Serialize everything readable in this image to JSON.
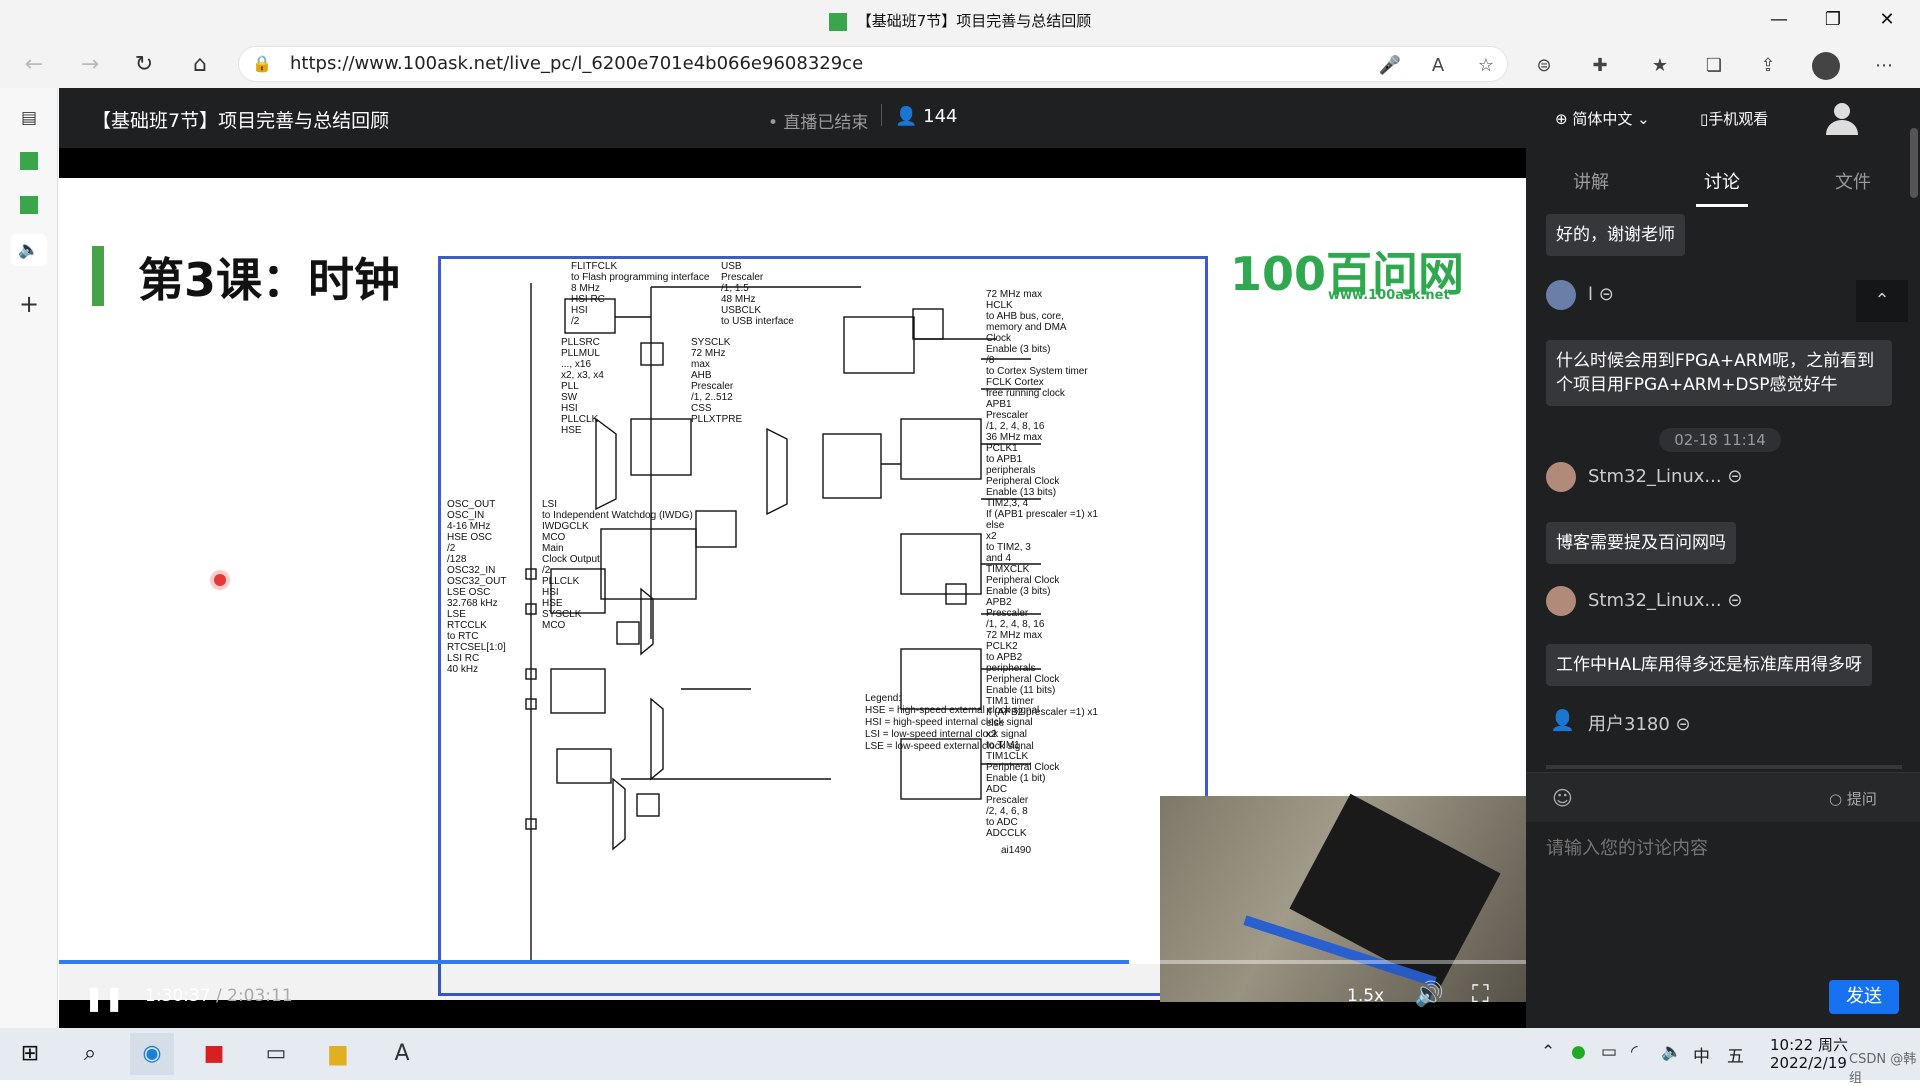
{
  "browser": {
    "tab_title": "【基础班7节】项目完善与总结回顾",
    "url": "https://www.100ask.net/live_pc/l_6200e701e4b066e9608329ce"
  },
  "page": {
    "title": "【基础班7节】项目完善与总结回顾",
    "live_status": "• 直播已结束",
    "viewer_count": "144",
    "language": "简体中文",
    "mobile_watch": "手机观看"
  },
  "slide": {
    "lesson_title": "第3课：时钟",
    "logo_text": "100百问网",
    "logo_url": "www.100ask.net"
  },
  "diagram": {
    "top_labels": [
      "FLITFCLK",
      "to Flash programming interface",
      "8 MHz",
      "HSI RC",
      "HSI",
      "/2",
      "USB",
      "Prescaler",
      "/1, 1.5",
      "48 MHz",
      "USBCLK",
      "to USB interface"
    ],
    "pll_labels": [
      "PLLSRC",
      "PLLMUL",
      "..., x16",
      "x2, x3, x4",
      "PLL",
      "SW",
      "HSI",
      "PLLCLK",
      "HSE",
      "SYSCLK",
      "72 MHz",
      "max",
      "AHB",
      "Prescaler",
      "/1, 2..512",
      "CSS",
      "PLLXTPRE"
    ],
    "osc_labels": [
      "OSC_OUT",
      "OSC_IN",
      "4-16 MHz",
      "HSE OSC",
      "/2",
      "/128",
      "OSC32_IN",
      "OSC32_OUT",
      "LSE OSC",
      "32.768 kHz",
      "LSE",
      "RTCCLK",
      "to RTC",
      "RTCSEL[1:0]",
      "LSI RC",
      "40 kHz",
      "LSI",
      "to Independent Watchdog (IWDG)",
      "IWDGCLK",
      "MCO",
      "Main",
      "Clock Output",
      "/2",
      "PLLCLK",
      "HSI",
      "HSE",
      "SYSCLK",
      "MCO"
    ],
    "right_labels": [
      "72 MHz max",
      "HCLK",
      "to AHB bus, core,",
      "memory and DMA",
      "Clock",
      "Enable (3 bits)",
      "/8",
      "to Cortex System timer",
      "FCLK Cortex",
      "free running clock",
      "APB1",
      "Prescaler",
      "/1, 2, 4, 8, 16",
      "36 MHz max",
      "PCLK1",
      "to APB1",
      "peripherals",
      "Peripheral Clock",
      "Enable (13 bits)",
      "TIM2,3, 4",
      "If (APB1 prescaler =1) x1",
      "else",
      "x2",
      "to TIM2, 3",
      "and 4",
      "TIMXCLK",
      "Peripheral Clock",
      "Enable (3 bits)",
      "APB2",
      "Prescaler",
      "/1, 2, 4, 8, 16",
      "72 MHz max",
      "PCLK2",
      "to APB2",
      "peripherals",
      "Peripheral Clock",
      "Enable (11 bits)",
      "TIM1 timer",
      "If (APB2 prescaler =1) x1",
      "else",
      "x2",
      "to TIM1",
      "TIM1CLK",
      "Peripheral Clock",
      "Enable (1 bit)",
      "ADC",
      "Prescaler",
      "/2, 4, 6, 8",
      "to ADC",
      "ADCCLK"
    ],
    "legend": [
      "Legend:",
      "HSE = high-speed external clock signal",
      "HSI = high-speed internal clock signal",
      "LSI = low-speed internal clock signal",
      "LSE = low-speed external clock signal"
    ],
    "figure_id": "ai1490"
  },
  "player": {
    "time_current": "1:30:37",
    "time_total": "/ 2:03:11",
    "speed": "1.5x",
    "progress": 0.732
  },
  "panel": {
    "tabs": [
      "讲解",
      "讨论",
      "文件"
    ],
    "active_tab": "讨论",
    "messages": [
      {
        "text": "好的，谢谢老师"
      },
      {
        "user": "l"
      },
      {
        "text": "什么时候会用到FPGA+ARM呢，之前看到个项目用FPGA+ARM+DSP感觉好牛"
      },
      {
        "timestamp": "02-18 11:14"
      },
      {
        "user": "Stm32_Linux..."
      },
      {
        "text": "博客需要提及百问网吗"
      },
      {
        "user": "Stm32_Linux..."
      },
      {
        "text": "工作中HAL库用得多还是标准库用得多呀"
      },
      {
        "user": "用户3180"
      }
    ],
    "ask_label": "提问",
    "input_placeholder": "请输入您的讨论内容",
    "send_label": "发送"
  },
  "taskbar": {
    "ime_lang": "中",
    "ime_mode": "五",
    "time": "10:22 周六",
    "date": "2022/2/19",
    "watermark": "CSDN @韩组"
  },
  "colors": {
    "accent": "#1672f0",
    "slide_green": "#48a348",
    "diagram_border": "#3a5bd1",
    "panel_bg": "#1f2021"
  }
}
